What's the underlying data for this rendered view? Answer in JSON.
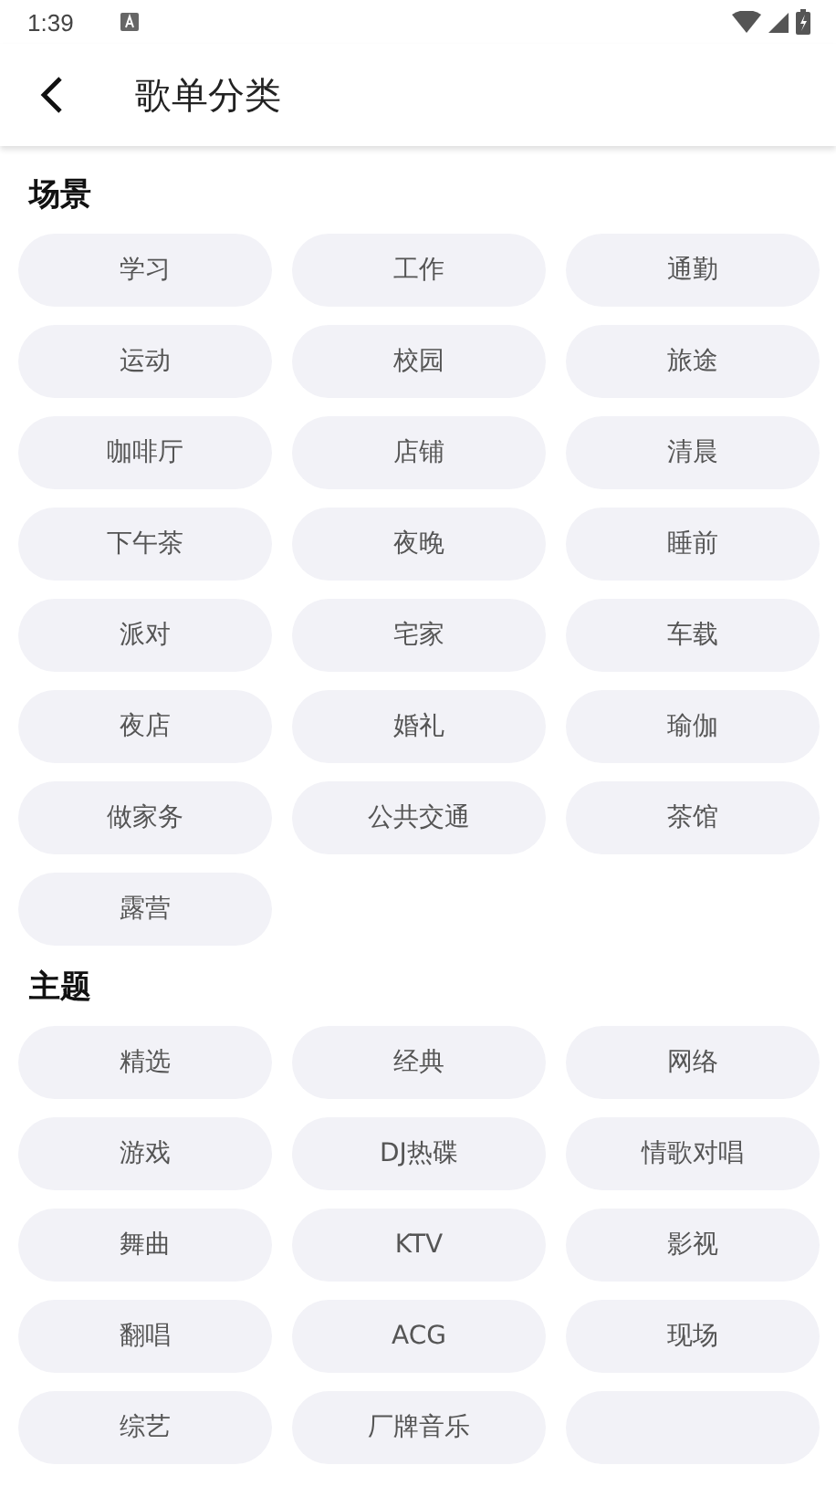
{
  "status_bar": {
    "time": "1:39"
  },
  "header": {
    "title": "歌单分类"
  },
  "sections": [
    {
      "title": "场景",
      "chips": [
        "学习",
        "工作",
        "通勤",
        "运动",
        "校园",
        "旅途",
        "咖啡厅",
        "店铺",
        "清晨",
        "下午茶",
        "夜晚",
        "睡前",
        "派对",
        "宅家",
        "车载",
        "夜店",
        "婚礼",
        "瑜伽",
        "做家务",
        "公共交通",
        "茶馆",
        "露营"
      ]
    },
    {
      "title": "主题",
      "trailing_blank_chip": true,
      "chips": [
        "精选",
        "经典",
        "网络",
        "游戏",
        "DJ热碟",
        "情歌对唱",
        "舞曲",
        "KTV",
        "影视",
        "翻唱",
        "ACG",
        "现场",
        "综艺",
        "厂牌音乐"
      ]
    }
  ]
}
